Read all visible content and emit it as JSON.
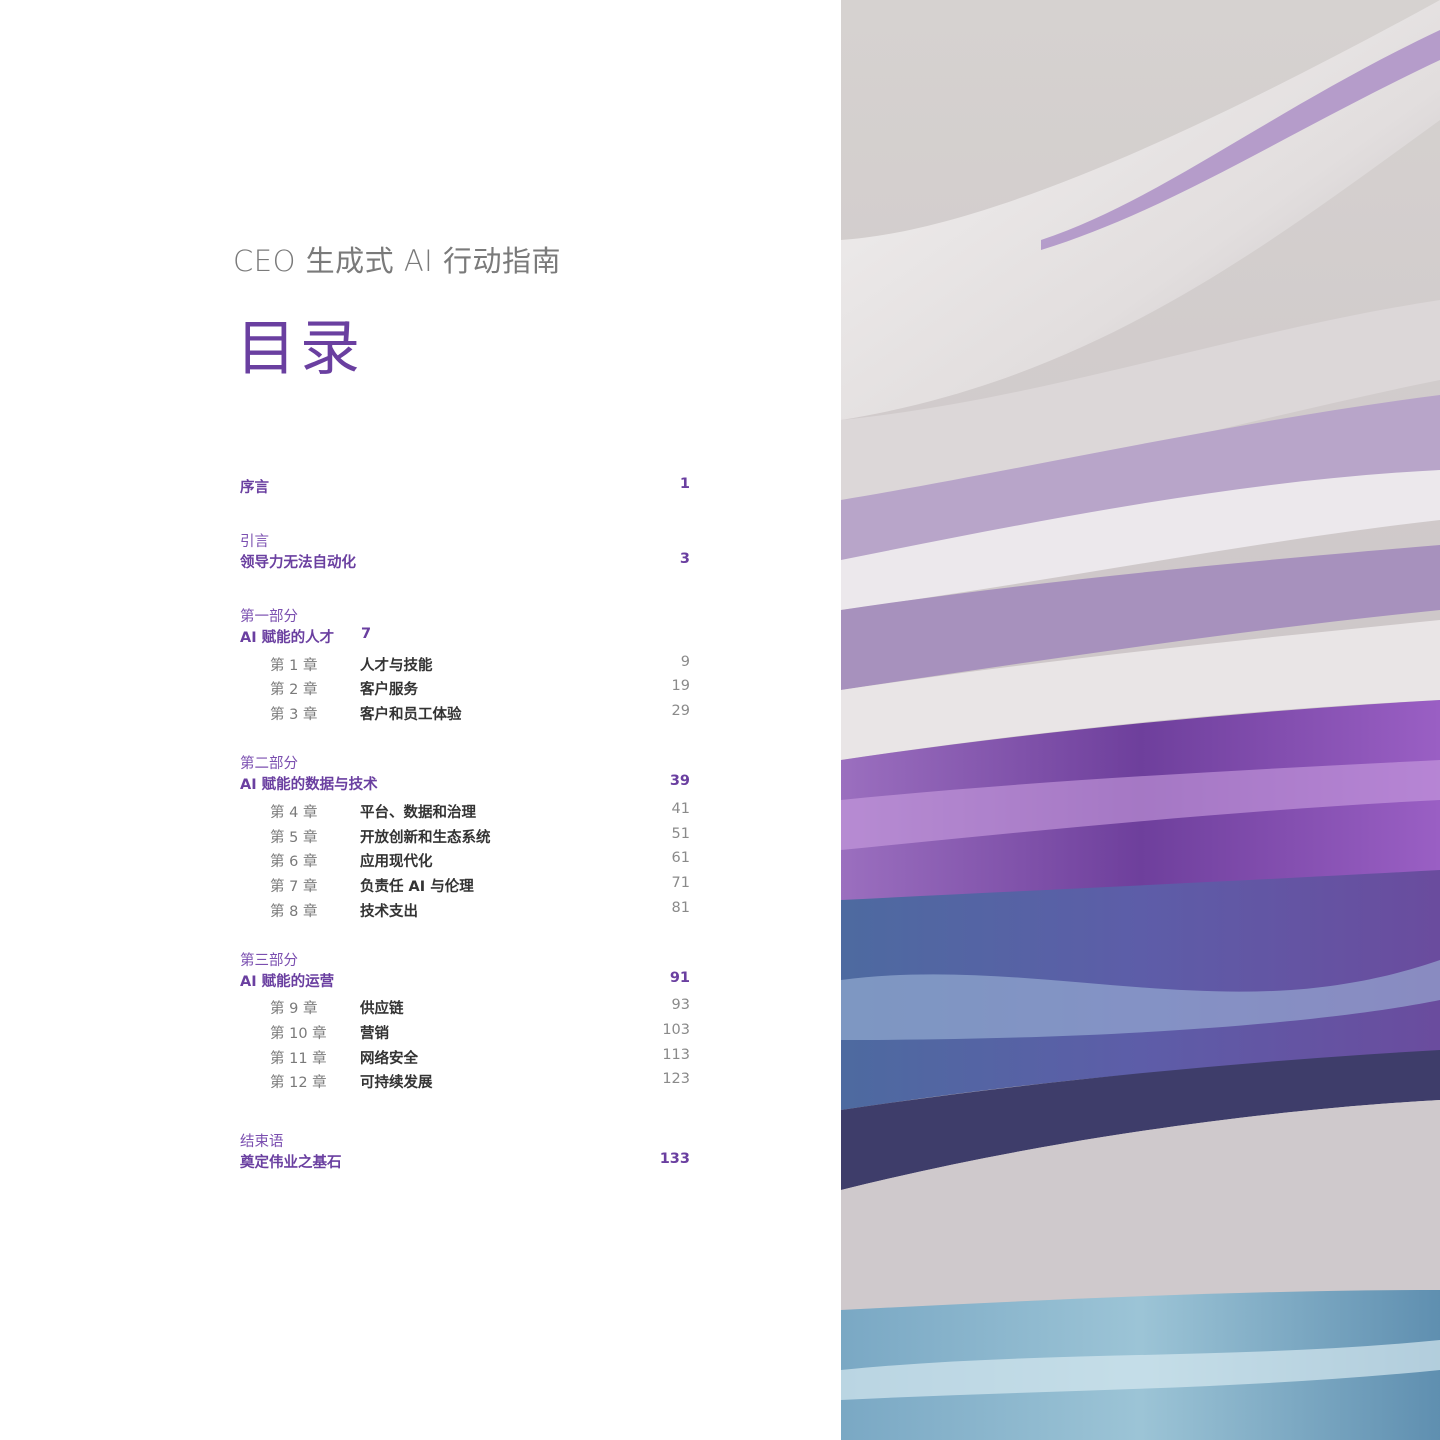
{
  "header": {
    "subtitle": "CEO 生成式 AI 行动指南",
    "title": "目录"
  },
  "toc": {
    "preface": {
      "title": "序言",
      "page": "1"
    },
    "intro": {
      "kicker": "引言",
      "title": "领导力无法自动化",
      "page": "3"
    },
    "part1": {
      "kicker": "第一部分",
      "title": "AI 赋能的人才",
      "page": "7",
      "chapters": [
        {
          "num": "第 1 章",
          "name": "人才与技能",
          "page": "9"
        },
        {
          "num": "第 2 章",
          "name": "客户服务",
          "page": "19"
        },
        {
          "num": "第 3 章",
          "name": "客户和员工体验",
          "page": "29"
        }
      ]
    },
    "part2": {
      "kicker": "第二部分",
      "title": "AI 赋能的数据与技术",
      "page": "39",
      "chapters": [
        {
          "num": "第 4 章",
          "name": "平台、数据和治理",
          "page": "41"
        },
        {
          "num": "第 5 章",
          "name": "开放创新和生态系统",
          "page": "51"
        },
        {
          "num": "第 6 章",
          "name": "应用现代化",
          "page": "61"
        },
        {
          "num": "第 7 章",
          "name": "负责任 AI 与伦理",
          "page": "71"
        },
        {
          "num": "第 8 章",
          "name": "技术支出",
          "page": "81"
        }
      ]
    },
    "part3": {
      "kicker": "第三部分",
      "title": "AI 赋能的运营",
      "page": "91",
      "chapters": [
        {
          "num": "第 9 章",
          "name": "供应链",
          "page": "93"
        },
        {
          "num": "第 10 章",
          "name": "营销",
          "page": "103"
        },
        {
          "num": "第 11 章",
          "name": "网络安全",
          "page": "113"
        },
        {
          "num": "第 12 章",
          "name": "可持续发展",
          "page": "123"
        }
      ]
    },
    "conclusion": {
      "kicker": "结束语",
      "title": "奠定伟业之基石",
      "page": "133"
    }
  },
  "colors": {
    "accent": "#6a3fa0",
    "muted": "#7a7a7a",
    "body": "#333333"
  }
}
